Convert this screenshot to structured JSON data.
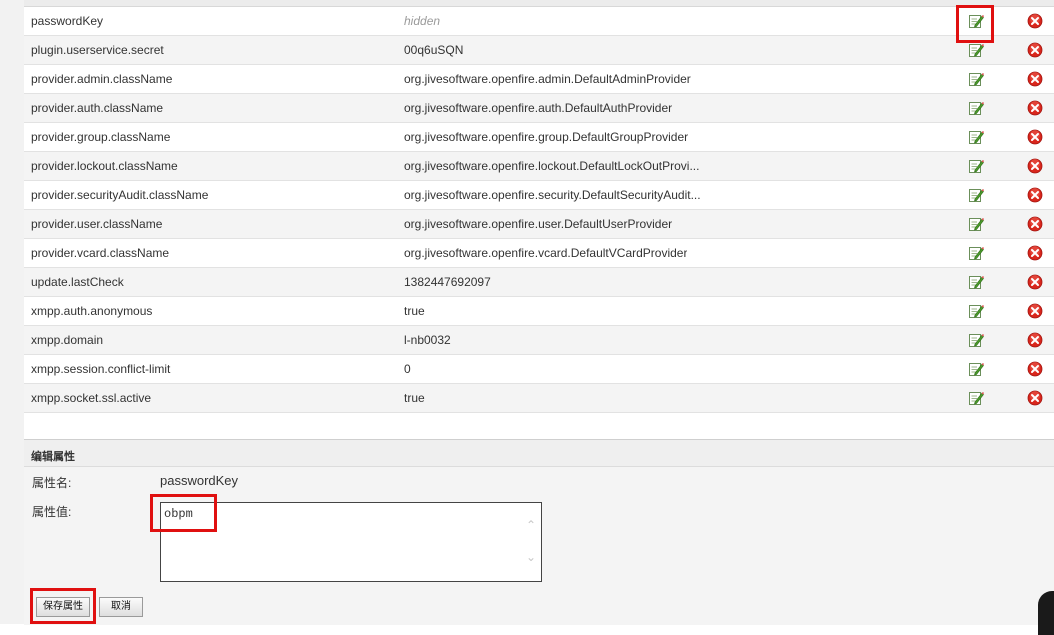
{
  "properties": [
    {
      "name": "passwordKey",
      "value": "hidden",
      "hidden": true
    },
    {
      "name": "plugin.userservice.secret",
      "value": "00q6uSQN"
    },
    {
      "name": "provider.admin.className",
      "value": "org.jivesoftware.openfire.admin.DefaultAdminProvider"
    },
    {
      "name": "provider.auth.className",
      "value": "org.jivesoftware.openfire.auth.DefaultAuthProvider"
    },
    {
      "name": "provider.group.className",
      "value": "org.jivesoftware.openfire.group.DefaultGroupProvider"
    },
    {
      "name": "provider.lockout.className",
      "value": "org.jivesoftware.openfire.lockout.DefaultLockOutProvi..."
    },
    {
      "name": "provider.securityAudit.className",
      "value": "org.jivesoftware.openfire.security.DefaultSecurityAudit..."
    },
    {
      "name": "provider.user.className",
      "value": "org.jivesoftware.openfire.user.DefaultUserProvider"
    },
    {
      "name": "provider.vcard.className",
      "value": "org.jivesoftware.openfire.vcard.DefaultVCardProvider"
    },
    {
      "name": "update.lastCheck",
      "value": "1382447692097"
    },
    {
      "name": "xmpp.auth.anonymous",
      "value": "true"
    },
    {
      "name": "xmpp.domain",
      "value": "l-nb0032"
    },
    {
      "name": "xmpp.session.conflict-limit",
      "value": "0"
    },
    {
      "name": "xmpp.socket.ssl.active",
      "value": "true"
    }
  ],
  "icons": {
    "edit": "edit-pencil-icon",
    "delete": "delete-x-icon"
  },
  "colors": {
    "highlight": "#e01010",
    "delete": "#d9261c",
    "edit": "#4a9a2a"
  },
  "edit_panel": {
    "title": "编辑属性",
    "name_label": "属性名:",
    "name_value": "passwordKey",
    "value_label": "属性值:",
    "value_text": "obpm",
    "save_label": "保存属性",
    "cancel_label": "取消"
  }
}
